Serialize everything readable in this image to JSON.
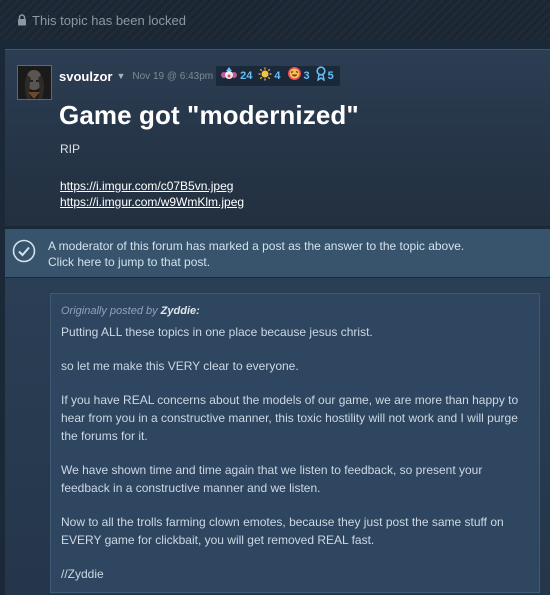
{
  "lock_notice": {
    "text": "This topic has been locked"
  },
  "post": {
    "author": "svoulzor",
    "date": "Nov 19 @ 6:43pm",
    "awards": [
      {
        "icon": "clown-award-icon",
        "count": "24",
        "color": "#c15a9c"
      },
      {
        "icon": "sun-award-icon",
        "count": "4",
        "color": "#f5c242"
      },
      {
        "icon": "laughing-face-award-icon",
        "count": "3",
        "color": "#e54b5b"
      },
      {
        "icon": "ribbon-award-icon",
        "count": "5",
        "color": "#66c0f4"
      }
    ],
    "title": "Game got \"modernized\"",
    "body": "RIP",
    "links": [
      "https://i.imgur.com/c07B5vn.jpeg",
      "https://i.imgur.com/w9WmKlm.jpeg"
    ]
  },
  "answer_banner": {
    "line1": "A moderator of this forum has marked a post as the answer to the topic above.",
    "line2": "Click here to jump to that post."
  },
  "quote": {
    "prefix": "Originally posted by",
    "author": "Zyddie:",
    "paragraphs": [
      "Putting ALL these topics in one place because jesus christ.",
      "so let me make this VERY clear to everyone.",
      "If you have REAL concerns about the models of our game, we are more than happy to hear from you in a constructive manner, this toxic hostility will not work and I will purge the forums for it.",
      "We have shown time and time again that we listen to feedback, so present your feedback in a constructive manner and we listen.",
      "Now to all the trolls farming clown emotes, because they just post the same stuff on EVERY game for clickbait, you will get removed REAL fast.",
      "//Zyddie"
    ]
  },
  "colors": {
    "accent_blue": "#66c0f4",
    "background": "#1b2838",
    "banner": "#38546c"
  }
}
